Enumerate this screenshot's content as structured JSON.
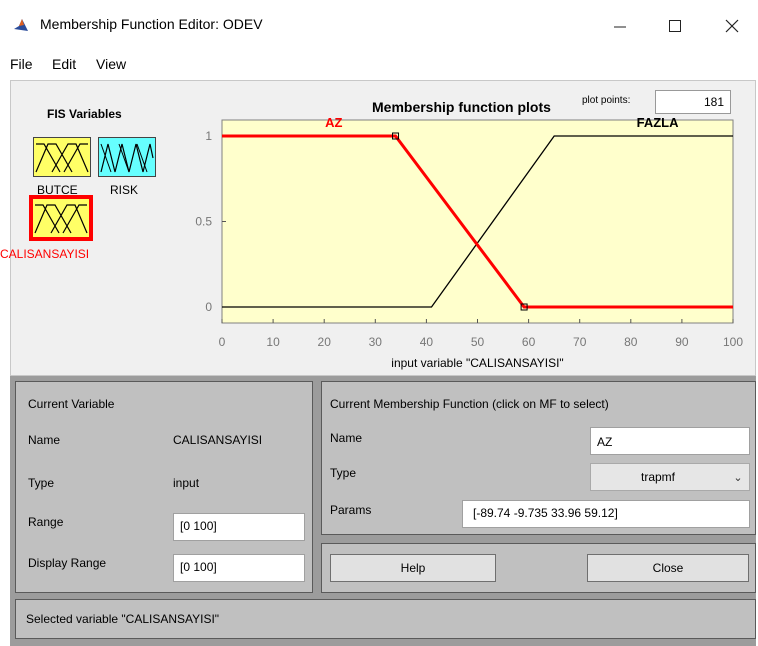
{
  "window": {
    "title": "Membership Function Editor: ODEV",
    "minimize_icon": "minimize-icon",
    "maximize_icon": "maximize-icon",
    "close_icon": "close-icon"
  },
  "menu": [
    "File",
    "Edit",
    "View"
  ],
  "fis_variables": {
    "title": "FIS Variables",
    "inputs": [
      {
        "label": "BUTCE",
        "color": "#ffff66"
      },
      {
        "label": "CALISANSAYISI",
        "color": "#ffff66",
        "selected": true
      }
    ],
    "outputs": [
      {
        "label": "RISK",
        "color": "#66ffff"
      }
    ],
    "selected_color": "#ff0000"
  },
  "plot": {
    "title": "Membership function plots",
    "plot_points_label": "plot points:",
    "plot_points_value": "181",
    "xlabel": "input variable \"CALISANSAYISI\""
  },
  "chart_data": {
    "type": "line",
    "xlim": [
      0,
      100
    ],
    "ylim": [
      0,
      1
    ],
    "xticks": [
      "0",
      "10",
      "20",
      "30",
      "40",
      "50",
      "60",
      "70",
      "80",
      "90",
      "100"
    ],
    "yticks": [
      "0",
      "0.5",
      "1"
    ],
    "background": "#ffffcc",
    "series": [
      {
        "name": "AZ",
        "type": "trapmf",
        "points": [
          [
            0,
            1
          ],
          [
            33.96,
            1
          ],
          [
            59.12,
            0
          ],
          [
            100,
            0
          ]
        ],
        "color": "#ff0000",
        "selected": true
      },
      {
        "name": "FAZLA",
        "type": "trapmf",
        "points": [
          [
            0,
            0
          ],
          [
            41,
            0
          ],
          [
            65,
            1
          ],
          [
            100,
            1
          ]
        ],
        "color": "#000000",
        "selected": false
      }
    ]
  },
  "current_variable": {
    "title": "Current Variable",
    "name_label": "Name",
    "name_value": "CALISANSAYISI",
    "type_label": "Type",
    "type_value": "input",
    "range_label": "Range",
    "range_value": "[0 100]",
    "display_range_label": "Display Range",
    "display_range_value": "[0 100]"
  },
  "current_mf": {
    "title": "Current Membership Function (click on MF to select)",
    "name_label": "Name",
    "name_value": "AZ",
    "type_label": "Type",
    "type_value": "trapmf",
    "params_label": "Params",
    "params_value": "[-89.74 -9.735 33.96 59.12]"
  },
  "buttons": {
    "help": "Help",
    "close": "Close"
  },
  "status": "Selected variable \"CALISANSAYISI\""
}
